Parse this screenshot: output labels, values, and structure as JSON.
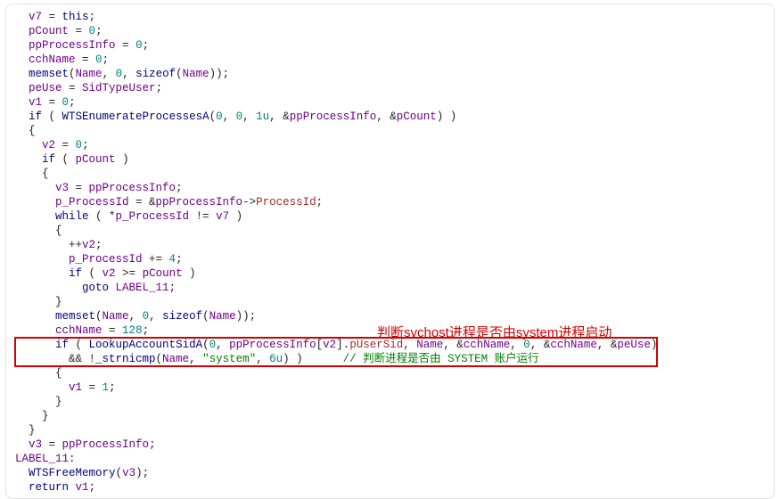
{
  "code": {
    "l1a": "v7",
    "l1b": "this",
    "l2a": "pCount",
    "l2b": "0",
    "l3a": "ppProcessInfo",
    "l3b": "0",
    "l4a": "cchName",
    "l4b": "0",
    "l5_fn": "memset",
    "l5_a1": "Name",
    "l5_a2": "0",
    "l5_sz": "sizeof",
    "l5_a3": "Name",
    "l6a": "peUse",
    "l6b": "SidTypeUser",
    "l7a": "v1",
    "l7b": "0",
    "l8_kw": "if",
    "l8_fn": "WTSEnumerateProcessesA",
    "l8_n1": "0",
    "l8_n2": "0",
    "l8_n3": "1u",
    "l8_a1": "ppProcessInfo",
    "l8_a2": "pCount",
    "l10a": "v2",
    "l10b": "0",
    "l11_kw": "if",
    "l11_v": "pCount",
    "l13a": "v3",
    "l13b": "ppProcessInfo",
    "l14a": "p_ProcessId",
    "l14b": "ppProcessInfo",
    "l14m": "ProcessId",
    "l15_kw": "while",
    "l15a": "p_ProcessId",
    "l15b": "v7",
    "l17a": "v2",
    "l18a": "p_ProcessId",
    "l18b": "4",
    "l19_kw": "if",
    "l19a": "v2",
    "l19b": "pCount",
    "l20_kw": "goto",
    "l20_lbl": "LABEL_11",
    "l22_fn": "memset",
    "l22_a1": "Name",
    "l22_a2": "0",
    "l22_sz": "sizeof",
    "l22_a3": "Name",
    "l23a": "cchName",
    "l23b": "128",
    "l24_kw": "if",
    "l24_fn": "LookupAccountSidA",
    "l24_n1": "0",
    "l24_a1": "ppProcessInfo",
    "l24_idx": "v2",
    "l24_m1": "pUserSid",
    "l24_a2": "Name",
    "l24_a3": "cchName",
    "l24_n2": "0",
    "l24_a4": "cchName",
    "l24_a5": "peUse",
    "l25_fn": "_strnicmp",
    "l25_a1": "Name",
    "l25_s": "\"system\"",
    "l25_n": "6u",
    "l25_cm": "// 判断进程是否由 SYSTEM 账户运行",
    "l27a": "v1",
    "l27b": "1",
    "l31a": "v3",
    "l31b": "ppProcessInfo",
    "l32_lbl": "LABEL_11",
    "l33_fn": "WTSFreeMemory",
    "l33_a": "v3",
    "l34_kw": "return",
    "l34_v": "v1"
  },
  "annotation": "判断svchost进程是否由system进程启动"
}
